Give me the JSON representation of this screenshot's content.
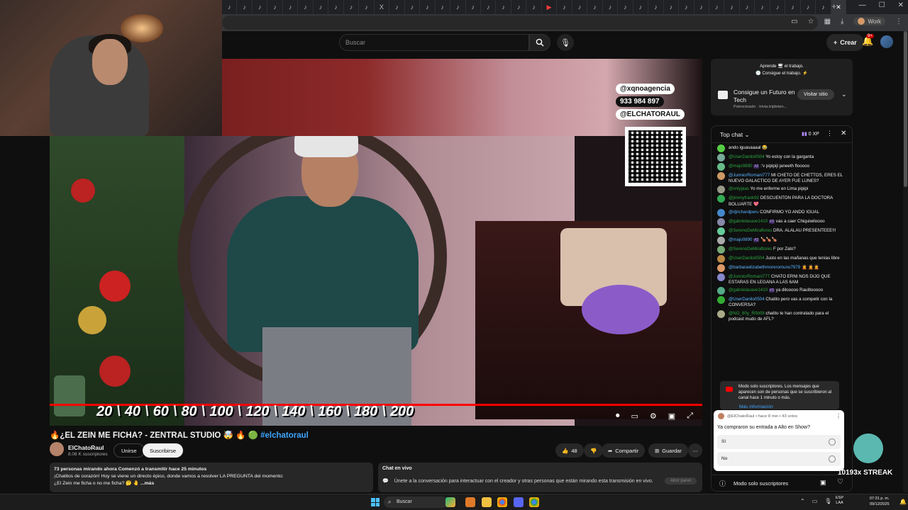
{
  "browser": {
    "tab_icons": [
      "♪",
      "♪",
      "♪",
      "♪",
      "♪",
      "♪",
      "♪",
      "♪",
      "♪",
      "♪",
      "X",
      "♪",
      "♪",
      "♪",
      "♪",
      "♪",
      "♪",
      "♪",
      "♪",
      "♪",
      "♪",
      "▶",
      "♪",
      "♪",
      "♪",
      "♪",
      "♪",
      "♪",
      "♪",
      "♪",
      "♪",
      "♪",
      "♪",
      "♪",
      "♪",
      "♪",
      "♪",
      "♪",
      "♪",
      "♪"
    ],
    "close_tab": "✕",
    "new_tab": "+",
    "profile_label": "Work"
  },
  "youtube": {
    "search_placeholder": "Buscar",
    "create_label": "Crear",
    "notifications_badge": "9+"
  },
  "video": {
    "overlay_instagram": "@xqnoagencia",
    "overlay_phone": "933 984 897",
    "overlay_handle": "@ELCHATORAUL",
    "speed_numbers": [
      "20",
      "40",
      "60",
      "80",
      "100",
      "120",
      "140",
      "160",
      "180",
      "200"
    ],
    "title": "🔥¿EL ZEIN ME FICHA? - ZENTRAL STUDIO 🤯 🔥 🟢",
    "title_hashtag": "#elchatoraul",
    "progress_fraction": 1.0
  },
  "channel": {
    "name": "ElChatoRaul",
    "subscribers": "8.08 K suscriptores",
    "join_label": "Unirse",
    "subscribe_label": "Suscribirse",
    "likes": "48",
    "share_label": "Compartir",
    "save_label": "Guardar"
  },
  "description": {
    "stats": "73 personas mirando ahora  Comenzó a transmitir hace 25 minutos",
    "line1": "¡Chatitos de corazón! Hoy se viene un directo épico, donde vamos a resolver LA PREGUNTA del momento:",
    "line2": "¿El Zein me ficha o no me ficha? 🤔 🤚",
    "more": "...más"
  },
  "live_chat_box": {
    "title": "Chat en vivo",
    "text": "Únete a la conversación para interactuar con el creador y otras personas que están mirando esta transmisión en vivo.",
    "open_panel": "Abrir panel"
  },
  "ad": {
    "header_line1": "Aprende 🖥 el trabajo.",
    "header_line2": "🕒 Consigue el trabajo. ⚡",
    "title": "Consigue un Futuro en Tech",
    "sponsored": "Patrocinado · trivia.tripleten...",
    "visit_label": "Visitar sitio"
  },
  "chat": {
    "header": "Top chat",
    "xp": "0 XP",
    "messages": [
      {
        "user": "",
        "text": "ando iguasaaaal 😂",
        "rank": ""
      },
      {
        "user": "@UserDanilo0504",
        "text": "Yo estoy con la garganta",
        "rank": ""
      },
      {
        "user": "@majo0890",
        "text": ":'v pipipiji janeeth flooooo",
        "rank": "#2"
      },
      {
        "user": "@JunniorRomani777",
        "text": "MI CHETO DE CHETTOS, ERES EL NUEVO GALACTICO DE AYER FUE LUNES?",
        "rank": ""
      },
      {
        "user": "@onlyjaas",
        "text": "Yo me enferme en Lima pipipi",
        "rank": ""
      },
      {
        "user": "@jimmyfrank92",
        "text": "DESCUENTON PARA LA DOCTORA BOLUARTE 💖",
        "rank": ""
      },
      {
        "user": "@djrichardperu",
        "text": "CONFIRMO YO ANDO IGUAL",
        "rank": ""
      },
      {
        "user": "@gabrielasave1410",
        "text": "vas a caer Chiquiwiloooo",
        "rank": "#3"
      },
      {
        "user": "@SerenoDeMiraflores",
        "text": "DRA. ALALAU PRESENTEEE!!!",
        "rank": ""
      },
      {
        "user": "@majo0890",
        "text": "🍗🍗🍗",
        "rank": "#2"
      },
      {
        "user": "@SerenoDeMiraflores",
        "text": "F por Zalo?",
        "rank": ""
      },
      {
        "user": "@UserDanilo0504",
        "text": "Justo en las mañanas que tenías libre",
        "rank": ""
      },
      {
        "user": "@barbaraelizabethmoreromuno7979",
        "text": "🤦 🤦🤦",
        "rank": ""
      },
      {
        "user": "@JunniorRomani777",
        "text": "CHATO ERNI NOS DIJO QUE ESTARAS EN LEGANA A LAS 6AM",
        "rank": ""
      },
      {
        "user": "@gabrielasave1410",
        "text": "ya dilooooo Raulitooooo",
        "rank": "#3"
      },
      {
        "user": "@UserDanilo0504",
        "text": "Chatito pero vas a competir con la CONVERSA?",
        "rank": ""
      },
      {
        "user": "@NO_80y_R0b08",
        "text": "chatito te han contratado para el podcast mudo de AFL?",
        "rank": ""
      }
    ],
    "subscribers_only": "Modo solo suscriptores. Los mensajes que aparecen son de personas que se suscribieron al canal hace 1 minuto o más.",
    "more_info": "Más información",
    "footer_mode": "Modo solo suscriptores"
  },
  "poll": {
    "meta": "@ElChatoRaul • hace 8 min • 43 votos",
    "question": "Ya compraron su entrada a Alto en Show?",
    "option1": "Sí",
    "option2": "No"
  },
  "streak": "10193x STREAK",
  "taskbar": {
    "search": "Buscar",
    "lang_line1": "ESP",
    "lang_line2": "LAA",
    "time": "07:31 p. m.",
    "date": "09/12/2025"
  },
  "colors": {
    "accent_red": "#ff0000",
    "link_blue": "#3ea6ff",
    "chat_user_green": "#2ba640"
  }
}
